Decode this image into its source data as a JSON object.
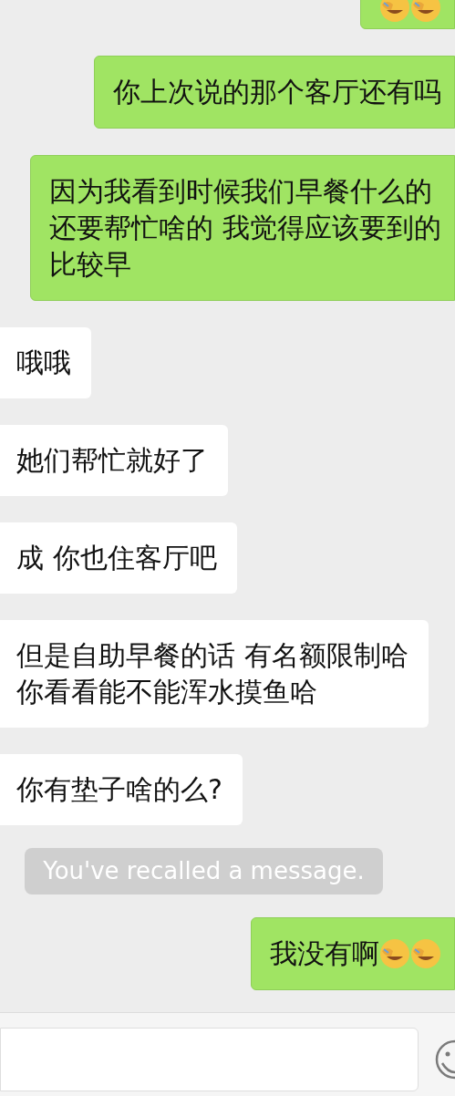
{
  "messages": [
    {
      "kind": "bubble",
      "outgoing": true,
      "trailing_icons": [
        {
          "kind": "emoji"
        },
        {
          "kind": "emoji"
        }
      ]
    },
    {
      "kind": "bubble",
      "outgoing": true,
      "lines": [
        "你上次说的那个客厅还有吗"
      ]
    },
    {
      "kind": "bubble",
      "outgoing": true,
      "lines": [
        "因为我看到时候我们早餐什么的",
        "还要帮忙啥的 我觉得应该要到的",
        "比较早"
      ]
    },
    {
      "kind": "bubble",
      "outgoing": false,
      "lines": [
        "哦哦"
      ]
    },
    {
      "kind": "bubble",
      "outgoing": false,
      "lines": [
        "她们帮忙就好了"
      ]
    },
    {
      "kind": "bubble",
      "outgoing": false,
      "lines": [
        "成 你也住客厅吧"
      ]
    },
    {
      "kind": "bubble",
      "outgoing": false,
      "lines": [
        "但是自助早餐的话 有名额限制哈",
        "你看看能不能浑水摸鱼哈"
      ]
    },
    {
      "kind": "bubble",
      "outgoing": false,
      "lines": [
        "你有垫子啥的么?"
      ]
    },
    {
      "kind": "notice",
      "text": "You've recalled a message."
    },
    {
      "kind": "bubble",
      "outgoing": true,
      "lines": [
        "我没有啊"
      ],
      "trailing_icons": [
        {
          "kind": "emoji"
        },
        {
          "kind": "emoji"
        }
      ]
    }
  ],
  "input_bar": {
    "emoji_button": true
  }
}
